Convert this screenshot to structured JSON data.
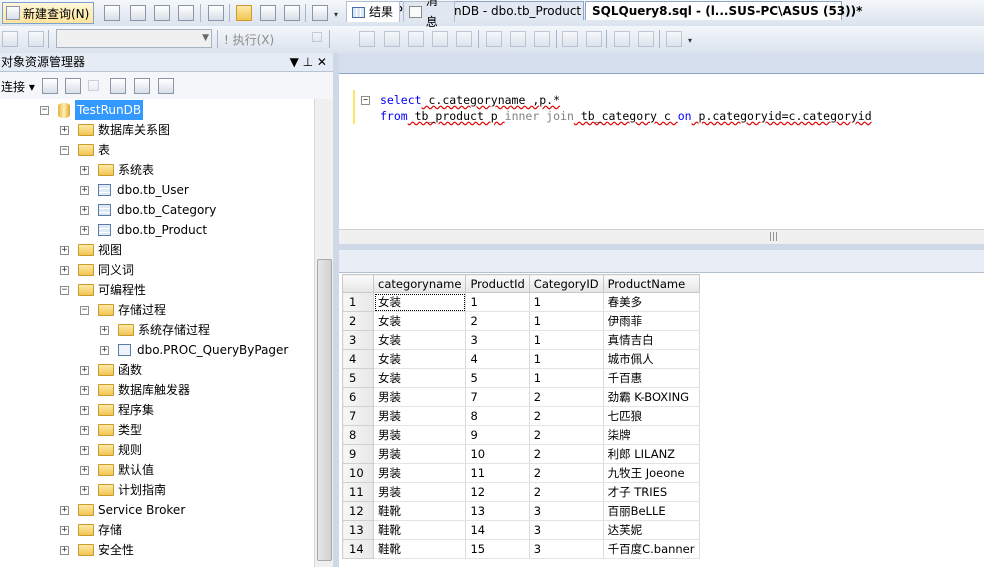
{
  "toolbar": {
    "new_query_label": "新建查询(N)",
    "execute_label": "! 执行(X)"
  },
  "object_explorer": {
    "title": "对象资源管理器",
    "pin_glyph": "▼ ⊥ ✕",
    "connect_label": "连接 ▾",
    "tree": [
      {
        "label": "TestRunDB",
        "type": "db",
        "expanded": true,
        "selected": true
      },
      {
        "label": "数据库关系图",
        "type": "folder",
        "expanded": false
      },
      {
        "label": "表",
        "type": "folder",
        "expanded": true
      },
      {
        "label": "系统表",
        "type": "folder",
        "expanded": false
      },
      {
        "label": "dbo.tb_User",
        "type": "table",
        "expanded": false
      },
      {
        "label": "dbo.tb_Category",
        "type": "table",
        "expanded": false
      },
      {
        "label": "dbo.tb_Product",
        "type": "table",
        "expanded": false
      },
      {
        "label": "视图",
        "type": "folder",
        "expanded": false
      },
      {
        "label": "同义词",
        "type": "folder",
        "expanded": false
      },
      {
        "label": "可编程性",
        "type": "folder",
        "expanded": true
      },
      {
        "label": "存储过程",
        "type": "folder",
        "expanded": true
      },
      {
        "label": "系统存储过程",
        "type": "folder",
        "expanded": false
      },
      {
        "label": "dbo.PROC_QueryByPager",
        "type": "proc",
        "expanded": false
      },
      {
        "label": "函数",
        "type": "folder",
        "expanded": false
      },
      {
        "label": "数据库触发器",
        "type": "folder",
        "expanded": false
      },
      {
        "label": "程序集",
        "type": "folder",
        "expanded": false
      },
      {
        "label": "类型",
        "type": "folder",
        "expanded": false
      },
      {
        "label": "规则",
        "type": "folder",
        "expanded": false
      },
      {
        "label": "默认值",
        "type": "folder",
        "expanded": false
      },
      {
        "label": "计划指南",
        "type": "folder",
        "expanded": false
      },
      {
        "label": "Service Broker",
        "type": "folder",
        "expanded": false
      },
      {
        "label": "存储",
        "type": "folder",
        "expanded": false
      },
      {
        "label": "安全性",
        "type": "folder",
        "expanded": false
      }
    ]
  },
  "editor_tabs": [
    {
      "label": "ASUS-PC.TestRunDB - dbo.tb_Product",
      "active": false
    },
    {
      "label": "SQLQuery8.sql - (l...SUS-PC\\ASUS (53))*",
      "active": true
    }
  ],
  "query": {
    "line1": {
      "k1": "select",
      "t1": " c.categoryname ,p.*"
    },
    "line2": {
      "k1": "from",
      "t1": " tb_product p ",
      "k2": "inner join",
      "t2": " tb_category c ",
      "k3": "on",
      "t3": " p.categoryid=c.categoryid"
    }
  },
  "results_tabs": [
    {
      "label": "结果",
      "icon": "grid-icon"
    },
    {
      "label": "消息",
      "icon": "message-icon"
    }
  ],
  "results": {
    "columns": [
      "categoryname",
      "ProductId",
      "CategoryID",
      "ProductName"
    ],
    "rows": [
      [
        "1",
        "女装",
        "1",
        "1",
        "春美多"
      ],
      [
        "2",
        "女装",
        "2",
        "1",
        "伊雨菲"
      ],
      [
        "3",
        "女装",
        "3",
        "1",
        "真情吉白"
      ],
      [
        "4",
        "女装",
        "4",
        "1",
        "城市佩人"
      ],
      [
        "5",
        "女装",
        "5",
        "1",
        "千百惠"
      ],
      [
        "6",
        "男装",
        "7",
        "2",
        "劲霸 K-BOXING"
      ],
      [
        "7",
        "男装",
        "8",
        "2",
        "七匹狼"
      ],
      [
        "8",
        "男装",
        "9",
        "2",
        "柒牌"
      ],
      [
        "9",
        "男装",
        "10",
        "2",
        "利郎 LILANZ"
      ],
      [
        "10",
        "男装",
        "11",
        "2",
        "九牧王 Joeone"
      ],
      [
        "11",
        "男装",
        "12",
        "2",
        "才子 TRIES"
      ],
      [
        "12",
        "鞋靴",
        "13",
        "3",
        "百丽BeLLE"
      ],
      [
        "13",
        "鞋靴",
        "14",
        "3",
        "达芙妮"
      ],
      [
        "14",
        "鞋靴",
        "15",
        "3",
        "千百度C.banner"
      ]
    ]
  }
}
